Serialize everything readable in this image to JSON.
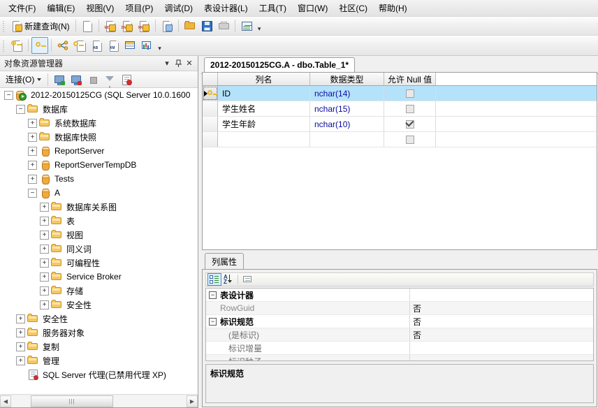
{
  "menubar": {
    "items": [
      {
        "label": "文件(F)"
      },
      {
        "label": "编辑(E)"
      },
      {
        "label": "视图(V)"
      },
      {
        "label": "项目(P)"
      },
      {
        "label": "调试(D)"
      },
      {
        "label": "表设计器(L)"
      },
      {
        "label": "工具(T)"
      },
      {
        "label": "窗口(W)"
      },
      {
        "label": "社区(C)"
      },
      {
        "label": "帮助(H)"
      }
    ]
  },
  "toolbar_main": {
    "new_query_label": "新建查询(N)",
    "icons": [
      "new-query-icon",
      "new-blank-query-icon",
      "new-mdx-query-icon",
      "new-dmx-query-icon",
      "new-xmla-query-icon",
      "new-file-icon",
      "open-file-icon",
      "save-icon",
      "print-icon",
      "analyze-icon"
    ],
    "overflow_label": "▾"
  },
  "toolbar_designer": {
    "icons": [
      "generate-change-script-icon",
      "set-primary-key-icon",
      "relationships-icon",
      "manage-indexes-icon",
      "manage-fulltext-index-icon",
      "manage-xml-indexes-icon",
      "manage-check-constraints-icon",
      "manage-partitions-icon"
    ],
    "selected_icon": "set-primary-key-icon",
    "overflow_label": "▾"
  },
  "object_explorer": {
    "title": "对象资源管理器",
    "header_buttons": [
      {
        "name": "dropdown",
        "glyph": "▾"
      },
      {
        "name": "auto-hide-pin",
        "glyph": "⌸"
      },
      {
        "name": "close",
        "glyph": "✕"
      }
    ],
    "toolbar": {
      "connect_label": "连接(O)",
      "icons": [
        "connect-object-explorer-icon",
        "disconnect-icon",
        "stop-icon",
        "filter-icon",
        "refresh-icon"
      ]
    },
    "tree": [
      {
        "label": "2012-20150125CG (SQL Server 10.0.1600",
        "depth": 0,
        "expander": "minus",
        "icon": "server-db-icon"
      },
      {
        "label": "数据库",
        "depth": 1,
        "expander": "minus",
        "icon": "folder-icon"
      },
      {
        "label": "系统数据库",
        "depth": 2,
        "expander": "plus",
        "icon": "folder-icon"
      },
      {
        "label": "数据库快照",
        "depth": 2,
        "expander": "plus",
        "icon": "folder-icon"
      },
      {
        "label": "ReportServer",
        "depth": 2,
        "expander": "plus",
        "icon": "database-icon"
      },
      {
        "label": "ReportServerTempDB",
        "depth": 2,
        "expander": "plus",
        "icon": "database-icon"
      },
      {
        "label": "Tests",
        "depth": 2,
        "expander": "plus",
        "icon": "database-icon"
      },
      {
        "label": "A",
        "depth": 2,
        "expander": "minus",
        "icon": "database-icon"
      },
      {
        "label": "数据库关系图",
        "depth": 3,
        "expander": "plus",
        "icon": "folder-icon"
      },
      {
        "label": "表",
        "depth": 3,
        "expander": "plus",
        "icon": "folder-icon"
      },
      {
        "label": "视图",
        "depth": 3,
        "expander": "plus",
        "icon": "folder-icon"
      },
      {
        "label": "同义词",
        "depth": 3,
        "expander": "plus",
        "icon": "folder-icon"
      },
      {
        "label": "可编程性",
        "depth": 3,
        "expander": "plus",
        "icon": "folder-icon"
      },
      {
        "label": "Service Broker",
        "depth": 3,
        "expander": "plus",
        "icon": "folder-icon"
      },
      {
        "label": "存储",
        "depth": 3,
        "expander": "plus",
        "icon": "folder-icon"
      },
      {
        "label": "安全性",
        "depth": 3,
        "expander": "plus",
        "icon": "folder-icon"
      },
      {
        "label": "安全性",
        "depth": 1,
        "expander": "plus",
        "icon": "folder-icon"
      },
      {
        "label": "服务器对象",
        "depth": 1,
        "expander": "plus",
        "icon": "folder-icon"
      },
      {
        "label": "复制",
        "depth": 1,
        "expander": "plus",
        "icon": "folder-icon"
      },
      {
        "label": "管理",
        "depth": 1,
        "expander": "plus",
        "icon": "folder-icon"
      },
      {
        "label": "SQL Server 代理(已禁用代理 XP)",
        "depth": 1,
        "expander": "none",
        "icon": "agent-icon"
      }
    ],
    "scrollbar": {
      "left_glyph": "◀",
      "right_glyph": "▶",
      "thumb_glyph": "|||"
    }
  },
  "editor": {
    "tab_label": "2012-20150125CG.A - dbo.Table_1*",
    "designer": {
      "columns": [
        "列名",
        "数据类型",
        "允许 Null 值"
      ],
      "rows": [
        {
          "key": true,
          "selected": true,
          "name": "ID",
          "type": "nchar(14)",
          "allow_null": false
        },
        {
          "key": false,
          "selected": false,
          "name": "学生姓名",
          "type": "nchar(15)",
          "allow_null": false
        },
        {
          "key": false,
          "selected": false,
          "name": "学生年龄",
          "type": "nchar(10)",
          "allow_null": true
        },
        {
          "key": false,
          "selected": false,
          "name": "",
          "type": "",
          "allow_null": false
        }
      ]
    }
  },
  "properties": {
    "tab_label": "列属性",
    "toolbar": {
      "icons": [
        "categorized-icon",
        "alphabetical-sort-icon",
        "property-pages-icon"
      ],
      "selected_icon": "categorized-icon"
    },
    "rows": [
      {
        "expander": "minus",
        "indent": 0,
        "label": "表设计器",
        "value": "",
        "style": "category"
      },
      {
        "expander": "none",
        "indent": 1,
        "label": "RowGuid",
        "value": "否",
        "style": "dim"
      },
      {
        "expander": "minus",
        "indent": 0,
        "label": "标识规范",
        "value": "否",
        "style": "category"
      },
      {
        "expander": "none",
        "indent": 2,
        "label": "(是标识)",
        "value": "否",
        "style": "sub"
      },
      {
        "expander": "none",
        "indent": 2,
        "label": "标识增量",
        "value": "",
        "style": "sub"
      },
      {
        "expander": "none",
        "indent": 2,
        "label": "标识种子",
        "value": "",
        "style": "sub"
      }
    ],
    "description": {
      "title": "标识规范",
      "text": ""
    }
  }
}
